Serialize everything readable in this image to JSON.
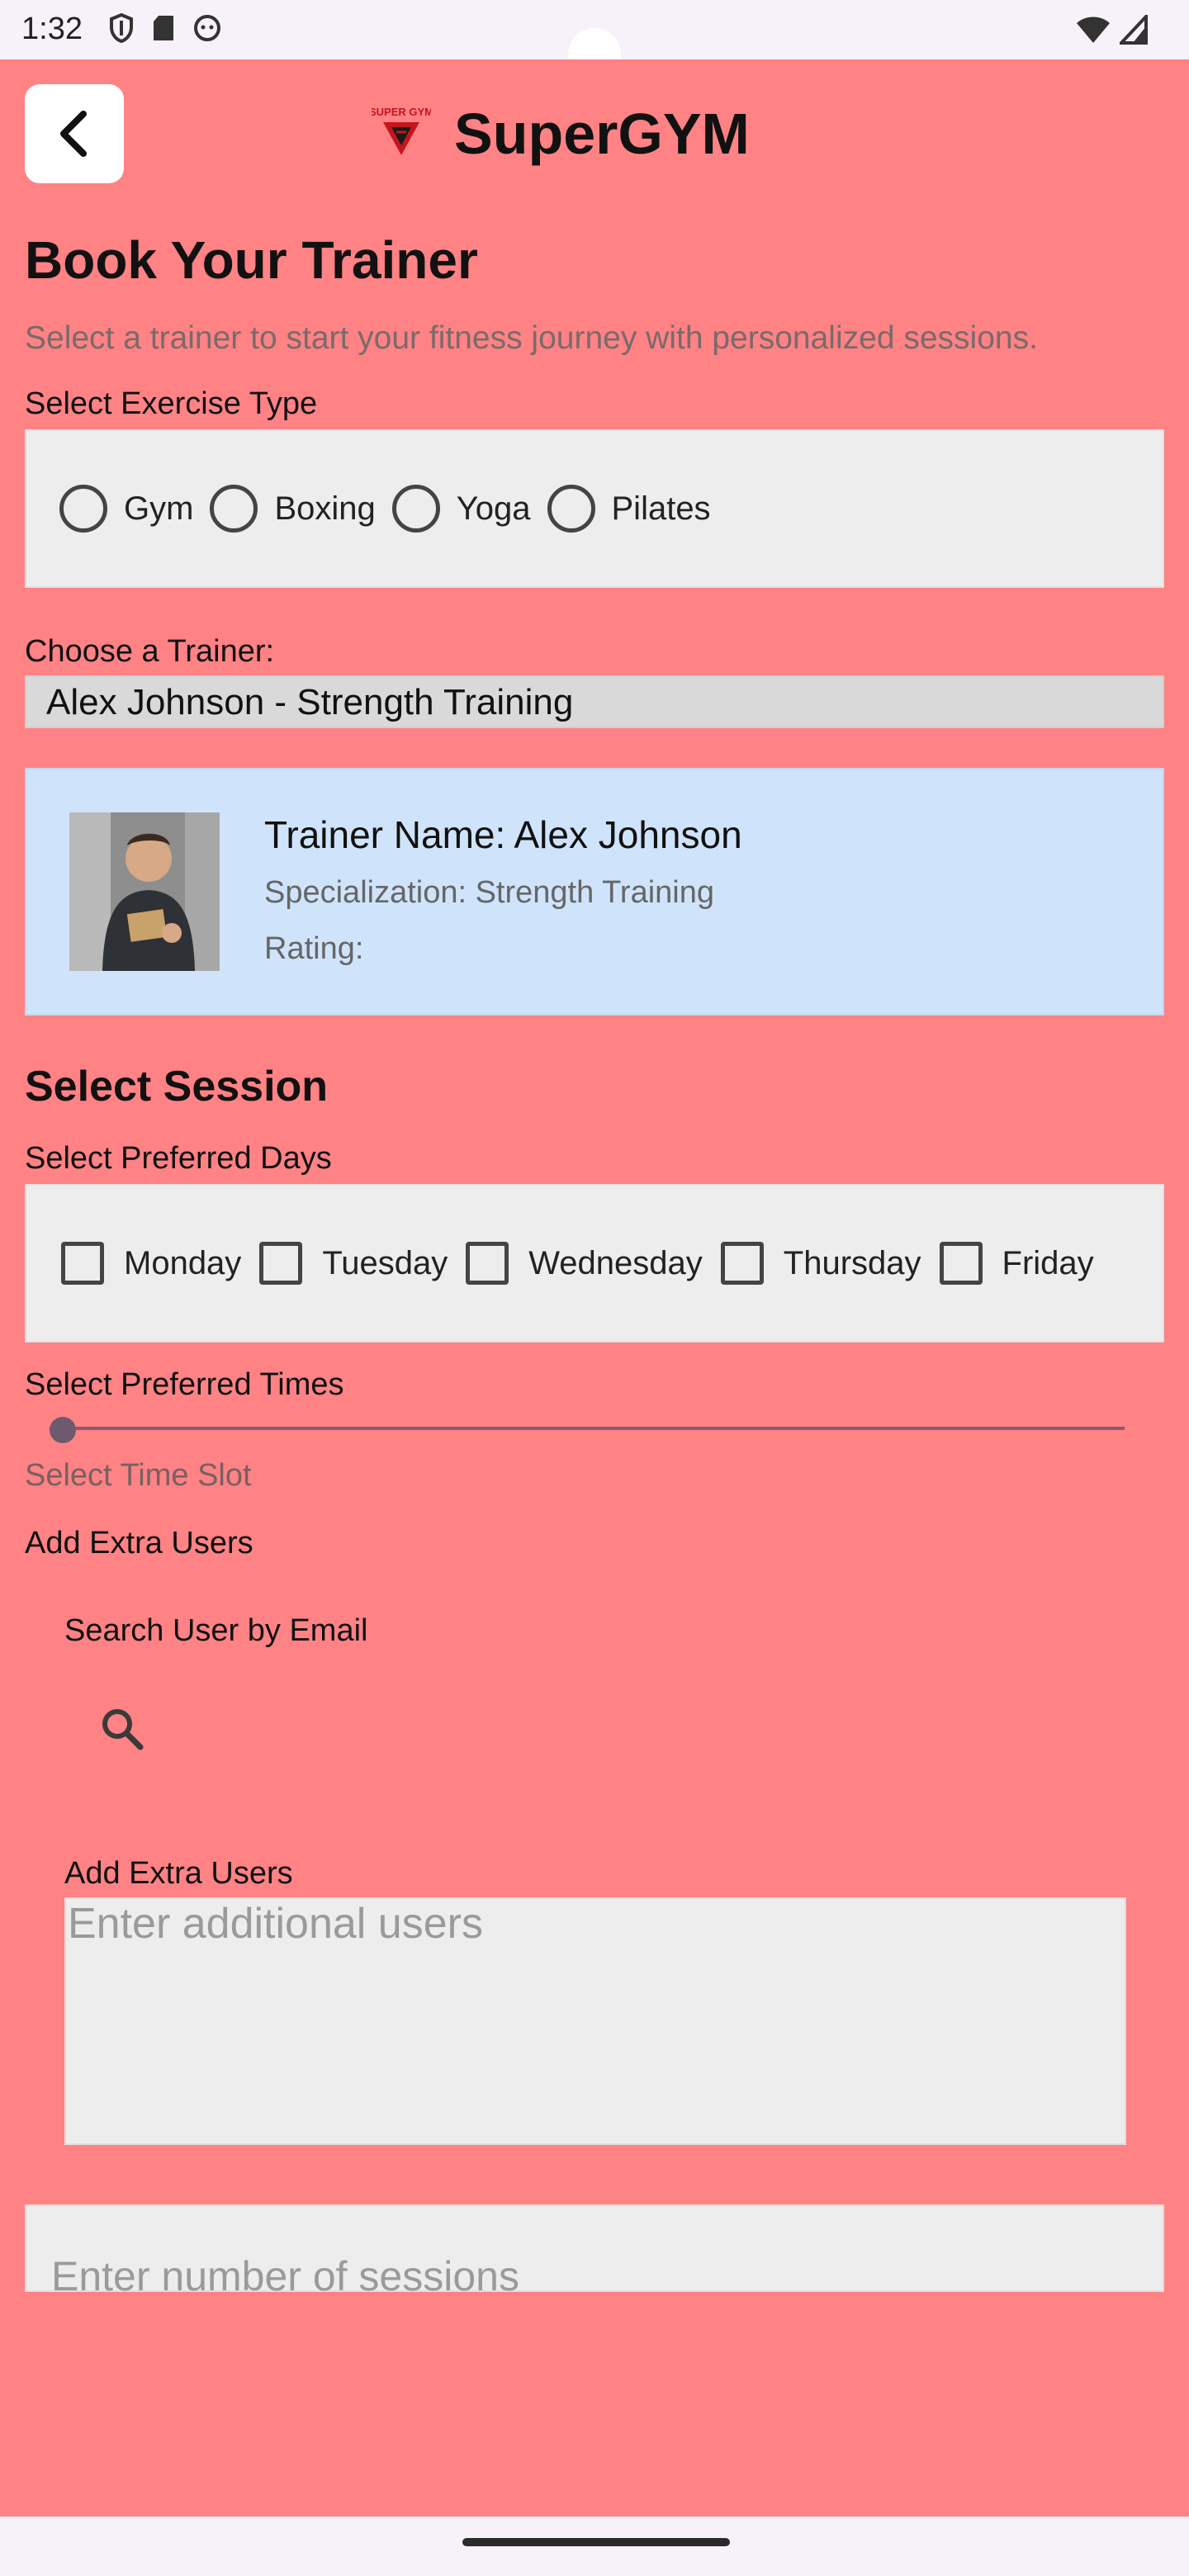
{
  "status_bar": {
    "time": "1:32"
  },
  "header": {
    "app_name": "SuperGYM",
    "logo_text": "SUPER GYM"
  },
  "page": {
    "title": "Book Your Trainer",
    "subtitle": "Select a trainer to start your fitness journey with personalized sessions."
  },
  "exercise": {
    "label": "Select Exercise Type",
    "options": [
      "Gym",
      "Boxing",
      "Yoga",
      "Pilates"
    ]
  },
  "trainer": {
    "label": "Choose a Trainer:",
    "selected": "Alex Johnson - Strength Training",
    "card": {
      "name": "Trainer Name: Alex Johnson",
      "specialization": "Specialization: Strength Training",
      "rating": "Rating:"
    }
  },
  "session": {
    "title": "Select Session",
    "days_label": "Select Preferred Days",
    "days": [
      "Monday",
      "Tuesday",
      "Wednesday",
      "Thursday",
      "Friday"
    ],
    "times_label": "Select Preferred Times",
    "time_slot_label": "Select Time Slot",
    "slider_value": 0
  },
  "extra_users": {
    "section_label": "Add Extra Users",
    "search_label": "Search User by Email",
    "field_label": "Add Extra Users",
    "placeholder": "Enter additional users"
  },
  "sessions_input": {
    "placeholder": "Enter number of sessions"
  },
  "colors": {
    "background": "#ff8285",
    "panel": "#eeeded",
    "card": "#cfe4fb"
  }
}
